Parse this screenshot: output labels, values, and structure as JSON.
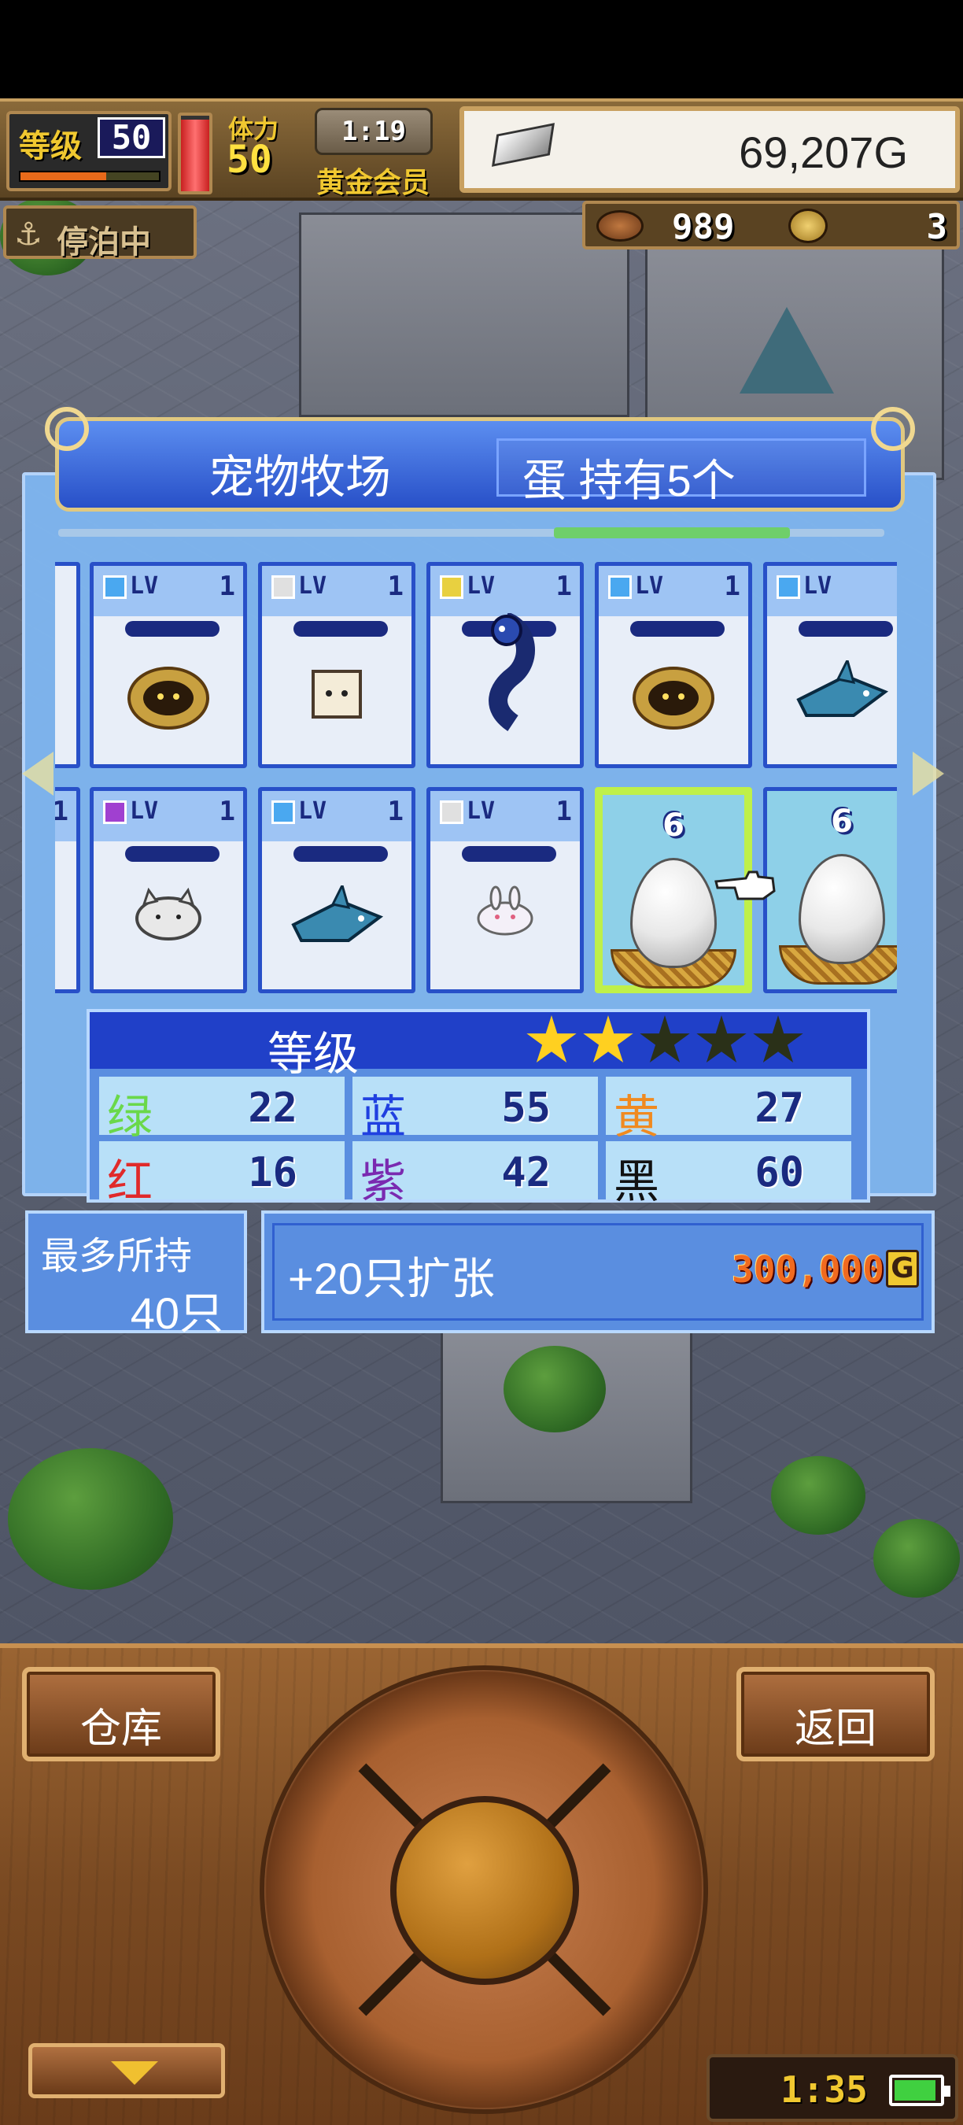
{
  "hud": {
    "level_label": "等级",
    "level_value": "50",
    "level_exp_fraction": 0.62,
    "hp_fraction": 0.95,
    "stamina_label": "体力",
    "stamina_value": "50",
    "clock": "1:19",
    "member_label": "黄金会员",
    "gold": "69,207G",
    "anchor_label": "停泊中",
    "resource_a": "989",
    "resource_b": "3"
  },
  "panel": {
    "title": "宠物牧场",
    "egg_info": "蛋 持有5个",
    "scroll_fraction": 0.6,
    "cards_row1": [
      {
        "gem": "blue",
        "lv": "LV",
        "level": "1",
        "pet": "clam"
      },
      {
        "gem": "white",
        "lv": "LV",
        "level": "1",
        "pet": "tofu"
      },
      {
        "gem": "yellow",
        "lv": "LV",
        "level": "1",
        "pet": "dragon"
      },
      {
        "gem": "blue",
        "lv": "LV",
        "level": "1",
        "pet": "clam"
      },
      {
        "gem": "blue",
        "lv": "LV",
        "level": "",
        "pet": "shark"
      }
    ],
    "cards_row2": [
      {
        "gem": "purple",
        "lv": "LV",
        "level": "1",
        "pet": "cat"
      },
      {
        "gem": "blue",
        "lv": "LV",
        "level": "1",
        "pet": "shark"
      },
      {
        "gem": "white",
        "lv": "LV",
        "level": "1",
        "pet": "rabbit"
      },
      {
        "type": "egg",
        "count": "6",
        "selected": true
      },
      {
        "type": "egg",
        "count": "6",
        "selected": false
      }
    ],
    "left_edge_level": "1"
  },
  "stats": {
    "title": "等级",
    "stars_filled": 2,
    "stars_total": 5,
    "rows": [
      [
        {
          "name": "绿",
          "value": "22",
          "color": "#6ad84a"
        },
        {
          "name": "蓝",
          "value": "55",
          "color": "#2040e0"
        },
        {
          "name": "黄",
          "value": "27",
          "color": "#f08a20"
        }
      ],
      [
        {
          "name": "红",
          "value": "16",
          "color": "#e02a2a"
        },
        {
          "name": "紫",
          "value": "42",
          "color": "#7a2ab0"
        },
        {
          "name": "黑",
          "value": "60",
          "color": "#111111"
        }
      ]
    ]
  },
  "capacity": {
    "label": "最多所持",
    "value": "40只"
  },
  "expand": {
    "label": "+20只扩张",
    "price": "300,000",
    "currency": "G"
  },
  "controls": {
    "left_button": "仓库",
    "right_button": "返回",
    "time": "1:35"
  }
}
